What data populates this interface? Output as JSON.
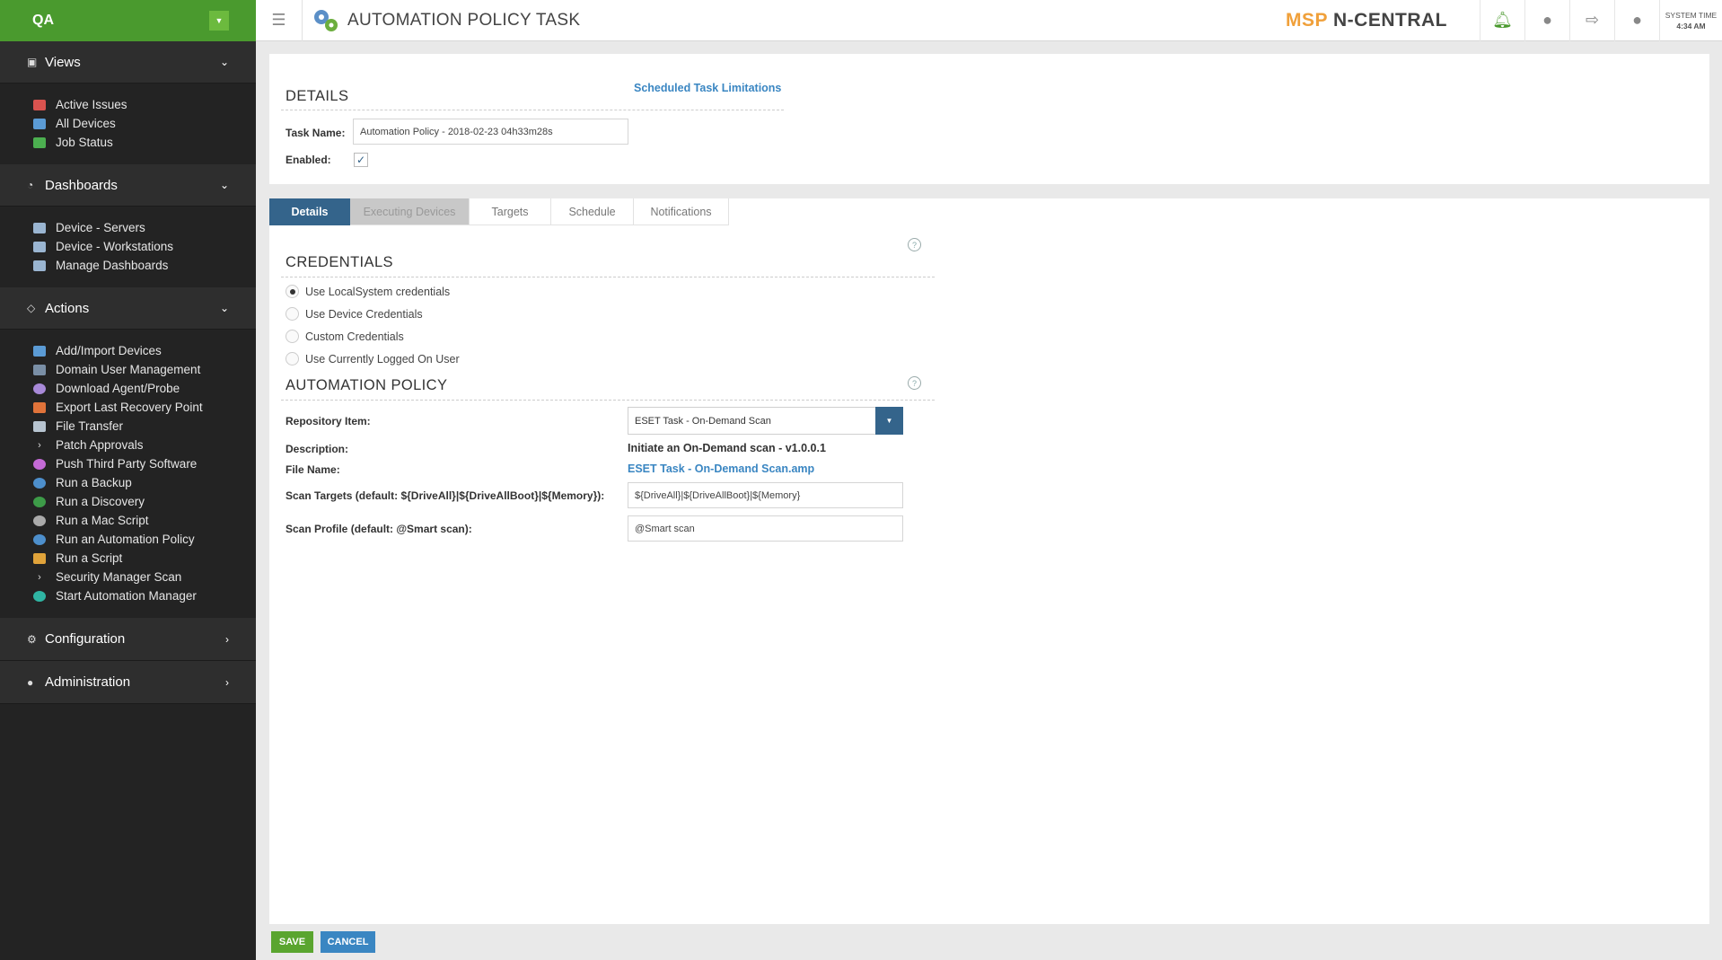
{
  "sidebar": {
    "org": "QA",
    "sections": [
      {
        "label": "Views",
        "icon": "views-icon"
      },
      {
        "label": "Dashboards",
        "icon": "dashboard-icon"
      },
      {
        "label": "Actions",
        "icon": "actions-icon"
      },
      {
        "label": "Configuration",
        "icon": "gear-icon"
      },
      {
        "label": "Administration",
        "icon": "user-icon"
      }
    ],
    "views": [
      "Active Issues",
      "All Devices",
      "Job Status"
    ],
    "dashboards": [
      "Device - Servers",
      "Device - Workstations",
      "Manage Dashboards"
    ],
    "actions": [
      "Add/Import Devices",
      "Domain User Management",
      "Download Agent/Probe",
      "Export Last Recovery Point",
      "File Transfer",
      "Patch Approvals",
      "Push Third Party Software",
      "Run a Backup",
      "Run a Discovery",
      "Run a Mac Script",
      "Run an Automation Policy",
      "Run a Script",
      "Security Manager Scan",
      "Start Automation Manager"
    ]
  },
  "header": {
    "title": "AUTOMATION POLICY TASK",
    "brand_msp": "MSP",
    "brand_nc": "N-CENTRAL",
    "systime_label": "SYSTEM TIME",
    "systime_value": "4:34 AM"
  },
  "details": {
    "heading": "DETAILS",
    "sched_link": "Scheduled Task Limitations",
    "task_name_label": "Task Name:",
    "task_name_value": "Automation Policy - 2018-02-23 04h33m28s",
    "enabled_label": "Enabled:",
    "enabled": true
  },
  "tabs": [
    "Details",
    "Executing Devices",
    "Targets",
    "Schedule",
    "Notifications"
  ],
  "credentials": {
    "heading": "CREDENTIALS",
    "options": [
      "Use LocalSystem credentials",
      "Use Device Credentials",
      "Custom Credentials",
      "Use Currently Logged On User"
    ],
    "selected": 0
  },
  "policy": {
    "heading": "AUTOMATION POLICY",
    "repo_label": "Repository Item:",
    "repo_value": "ESET Task - On-Demand Scan",
    "desc_label": "Description:",
    "desc_value": "Initiate an On-Demand scan - v1.0.0.1",
    "file_label": "File Name:",
    "file_value": "ESET Task - On-Demand Scan.amp",
    "scan_targets_label": "Scan Targets (default: ${DriveAll}|${DriveAllBoot}|${Memory}):",
    "scan_targets_value": "${DriveAll}|${DriveAllBoot}|${Memory}",
    "scan_profile_label": "Scan Profile (default: @Smart scan):",
    "scan_profile_value": "@Smart scan"
  },
  "footer": {
    "save": "SAVE",
    "cancel": "CANCEL"
  },
  "colors": {
    "brand_green": "#4a9a2e",
    "accent_blue": "#34648b",
    "link_blue": "#3a86c2",
    "msp_orange": "#f0a03a"
  }
}
